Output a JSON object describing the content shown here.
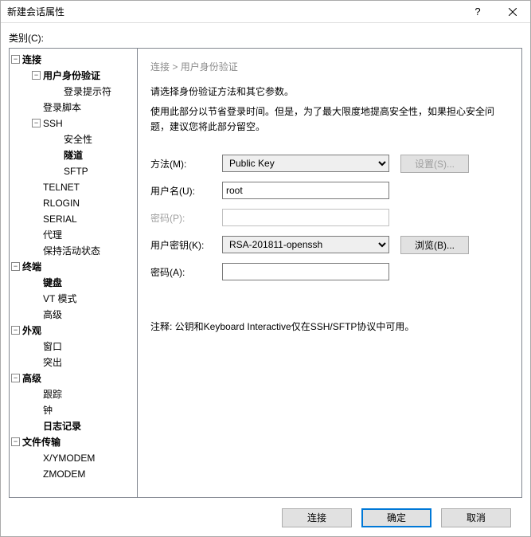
{
  "window": {
    "title": "新建会话属性"
  },
  "category_label": "类别(C):",
  "tree": {
    "connection": "连接",
    "auth": "用户身份验证",
    "login_prompt": "登录提示符",
    "login_script": "登录脚本",
    "ssh": "SSH",
    "security": "安全性",
    "tunnel": "隧道",
    "sftp": "SFTP",
    "telnet": "TELNET",
    "rlogin": "RLOGIN",
    "serial": "SERIAL",
    "proxy": "代理",
    "keepalive": "保持活动状态",
    "terminal": "终端",
    "keyboard": "键盘",
    "vtmode": "VT 模式",
    "advanced_term": "高级",
    "appearance": "外观",
    "window": "窗口",
    "highlight": "突出",
    "advanced": "高级",
    "trace": "跟踪",
    "bell": "钟",
    "logging": "日志记录",
    "filetransfer": "文件传输",
    "xymodem": "X/YMODEM",
    "zmodem": "ZMODEM"
  },
  "breadcrumb": {
    "a": "连接",
    "sep": ">",
    "b": "用户身份验证"
  },
  "desc1": "请选择身份验证方法和其它参数。",
  "desc2": "使用此部分以节省登录时间。但是，为了最大限度地提高安全性，如果担心安全问题，建议您将此部分留空。",
  "form": {
    "method_label": "方法(M):",
    "method_value": "Public Key",
    "setup_btn": "设置(S)...",
    "user_label": "用户名(U):",
    "user_value": "root",
    "pass_label": "密码(P):",
    "key_label": "用户密钥(K):",
    "key_value": "RSA-201811-openssh",
    "browse_btn": "浏览(B)...",
    "pass2_label": "密码(A):"
  },
  "note": "注释: 公钥和Keyboard Interactive仅在SSH/SFTP协议中可用。",
  "footer": {
    "connect": "连接",
    "ok": "确定",
    "cancel": "取消"
  }
}
